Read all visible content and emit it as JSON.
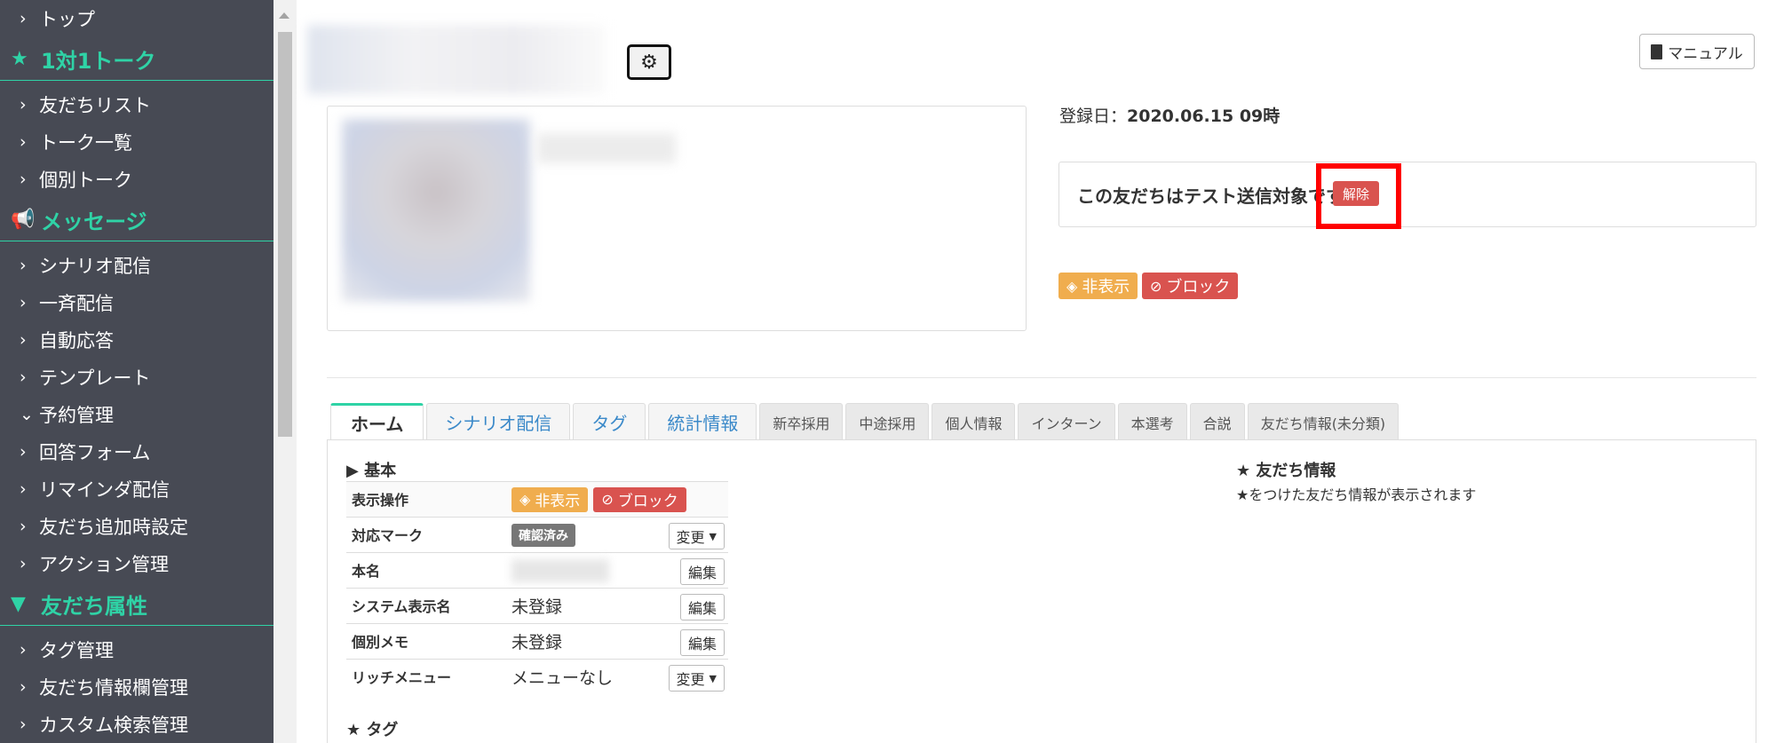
{
  "sidebar": {
    "items": [
      {
        "type": "item",
        "label": "トップ"
      },
      {
        "type": "section",
        "icon": "star-icon",
        "label": "1対1トーク"
      },
      {
        "type": "item",
        "label": "友だちリスト"
      },
      {
        "type": "item",
        "label": "トーク一覧"
      },
      {
        "type": "item",
        "label": "個別トーク"
      },
      {
        "type": "section",
        "icon": "megaphone-icon",
        "label": "メッセージ"
      },
      {
        "type": "item",
        "label": "シナリオ配信"
      },
      {
        "type": "item",
        "label": "一斉配信"
      },
      {
        "type": "item",
        "label": "自動応答"
      },
      {
        "type": "item",
        "label": "テンプレート"
      },
      {
        "type": "item",
        "label": "予約管理",
        "expanded": true
      },
      {
        "type": "item",
        "label": "回答フォーム"
      },
      {
        "type": "item",
        "label": "リマインダ配信"
      },
      {
        "type": "item",
        "label": "友だち追加時設定"
      },
      {
        "type": "item",
        "label": "アクション管理"
      },
      {
        "type": "section",
        "icon": "filter-icon",
        "label": "友だち属性"
      },
      {
        "type": "item",
        "label": "タグ管理"
      },
      {
        "type": "item",
        "label": "友だち情報欄管理"
      },
      {
        "type": "item",
        "label": "カスタム検索管理"
      }
    ]
  },
  "header": {
    "manual_label": "マニュアル"
  },
  "profile": {
    "registered_label": "登録日：",
    "registered_value": "2020.06.15 09時",
    "test_notice": "この友だちはテスト送信対象です",
    "unset_label": "解除",
    "hide_label": "非表示",
    "block_label": "ブロック"
  },
  "tabs": [
    {
      "label": "ホーム",
      "active": true,
      "size": "large"
    },
    {
      "label": "シナリオ配信",
      "size": "large"
    },
    {
      "label": "タグ",
      "size": "large"
    },
    {
      "label": "統計情報",
      "size": "large"
    },
    {
      "label": "新卒採用",
      "size": "small"
    },
    {
      "label": "中途採用",
      "size": "small"
    },
    {
      "label": "個人情報",
      "size": "small"
    },
    {
      "label": "インターン",
      "size": "small"
    },
    {
      "label": "本選考",
      "size": "small"
    },
    {
      "label": "合説",
      "size": "small"
    },
    {
      "label": "友だち情報(未分類)",
      "size": "small"
    }
  ],
  "basic": {
    "heading": "▶ 基本",
    "rows": {
      "display_ops": {
        "label": "表示操作",
        "hide": "非表示",
        "block": "ブロック"
      },
      "mark": {
        "label": "対応マーク",
        "value": "確認済み",
        "action": "変更"
      },
      "real_name": {
        "label": "本名",
        "action": "編集"
      },
      "system_name": {
        "label": "システム表示名",
        "value": "未登録",
        "action": "編集"
      },
      "memo": {
        "label": "個別メモ",
        "value": "未登録",
        "action": "編集"
      },
      "rich_menu": {
        "label": "リッチメニュー",
        "value": "メニューなし",
        "action": "変更"
      }
    }
  },
  "friend_info": {
    "heading": "★ 友だち情報",
    "description": "★をつけた友だち情報が表示されます"
  },
  "tag_section": {
    "heading": "★ タグ"
  }
}
